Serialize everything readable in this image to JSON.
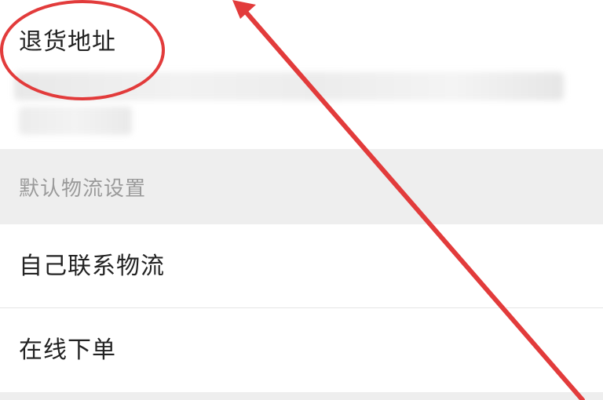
{
  "address": {
    "title": "退货地址"
  },
  "logistics": {
    "section_header": "默认物流设置",
    "options": [
      {
        "label": "自己联系物流"
      },
      {
        "label": "在线下单"
      }
    ]
  },
  "annotation": {
    "color": "#e23b3b",
    "circle_target": "退货地址",
    "arrow_icon": "arrow-up-left-icon"
  }
}
